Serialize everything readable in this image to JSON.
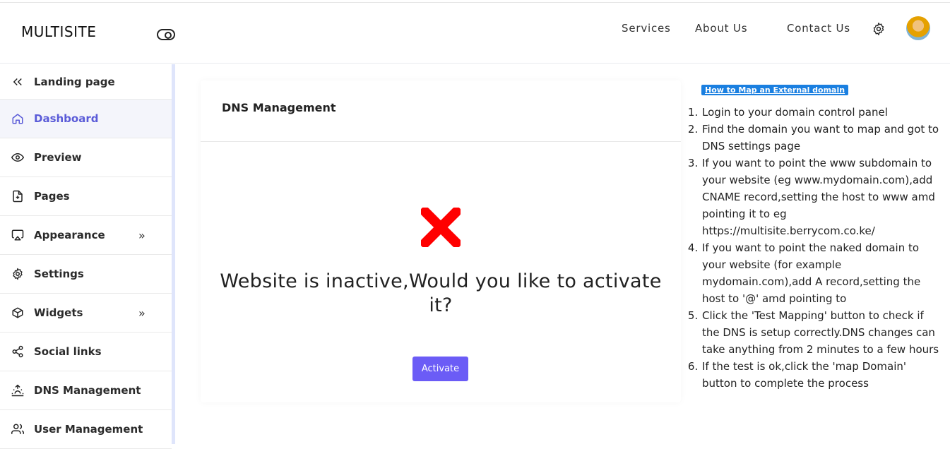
{
  "header": {
    "brand": "MULTISITE",
    "nav": [
      "Services",
      "About Us",
      "Contact Us"
    ]
  },
  "sidebar": {
    "items": [
      {
        "label": "Landing page",
        "icon": "double-left-arrow-icon"
      },
      {
        "label": "Dashboard",
        "icon": "home-icon",
        "active": true
      },
      {
        "label": "Preview",
        "icon": "eye-icon"
      },
      {
        "label": "Pages",
        "icon": "file-plus-icon"
      },
      {
        "label": "Appearance",
        "icon": "monitor-icon",
        "chevron": "»"
      },
      {
        "label": "Settings",
        "icon": "gear-icon"
      },
      {
        "label": "Widgets",
        "icon": "box-icon",
        "chevron": "»"
      },
      {
        "label": "Social links",
        "icon": "share-icon"
      },
      {
        "label": "DNS Management",
        "icon": "sunrise-icon"
      },
      {
        "label": "User Management",
        "icon": "users-icon"
      }
    ]
  },
  "main": {
    "title": "DNS Management",
    "message": "Website is inactive,Would you like to activate it?",
    "button": "Activate"
  },
  "help": {
    "link": "How to Map an External domain",
    "steps": [
      "Login to your domain control panel",
      "Find the domain you want to map and got to DNS settings page",
      "If you want to point the www subdomain to your website (eg www.mydomain.com),add CNAME record,setting the host to www amd pointing it to eg https://multisite.berrycom.co.ke/",
      "If you want to point the naked domain to your website (for example mydomain.com),add A record,setting the host to '@' amd pointing to",
      "Click the 'Test Mapping' button to check if the DNS is setup correctly.DNS changes can take anything from 2 minutes to a few hours",
      "If the test is ok,click the 'map Domain' button to complete the process"
    ]
  },
  "colors": {
    "accent": "#6b5cf6",
    "active_text": "#5a5bd8",
    "link_bg": "#1a7fe0",
    "error": "#ff0000"
  }
}
